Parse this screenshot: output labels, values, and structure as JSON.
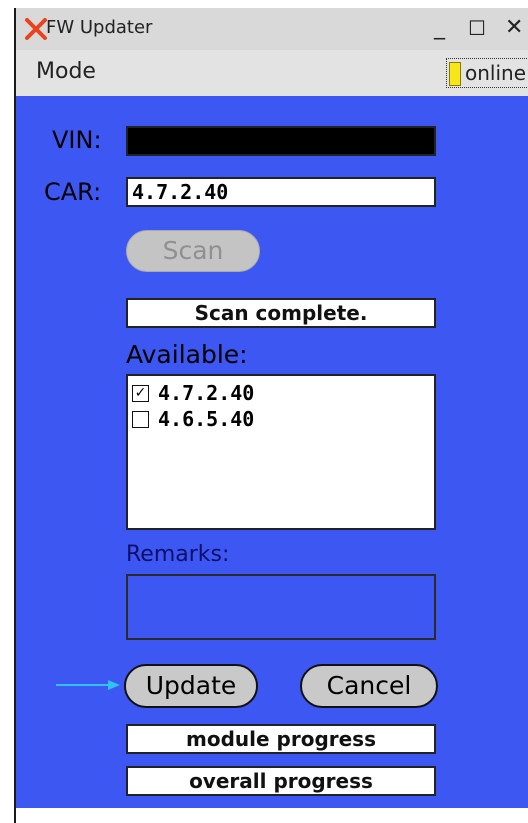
{
  "window": {
    "title": "FW Updater",
    "minimize_glyph": "_",
    "maximize_glyph": "☐",
    "close_glyph": "✕"
  },
  "menubar": {
    "mode_label": "Mode",
    "online_label": "online",
    "online_led_color": "#f6e61a"
  },
  "form": {
    "vin_label": "VIN:",
    "vin_value": "",
    "car_label": "CAR:",
    "car_value": "4.7.2.40",
    "scan_label": "Scan",
    "status_text": "Scan complete.",
    "available_label": "Available:",
    "available_items": [
      {
        "version": "4.7.2.40",
        "checked": true
      },
      {
        "version": "4.6.5.40",
        "checked": false
      }
    ],
    "remarks_label": "Remarks:",
    "remarks_value": "",
    "update_label": "Update",
    "cancel_label": "Cancel",
    "module_progress_label": "module progress",
    "overall_progress_label": "overall progress"
  },
  "colors": {
    "panel_bg": "#3c57f2",
    "arrow": "#2ec3f0",
    "logo": "#e8431c"
  }
}
